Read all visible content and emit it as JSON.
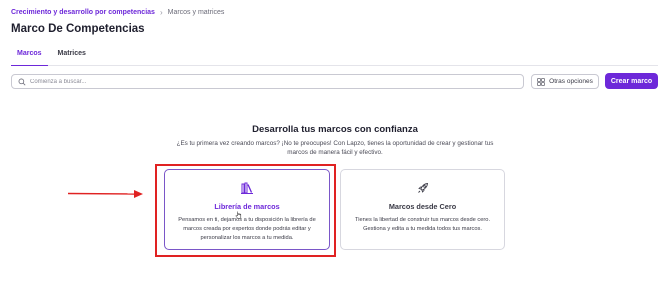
{
  "breadcrumb": {
    "parent": "Crecimiento y desarrollo por competencias",
    "separator_icon": "chevron-right-icon",
    "current": "Marcos y matrices"
  },
  "page": {
    "title": "Marco De Competencias"
  },
  "tabs": [
    {
      "label": "Marcos",
      "active": true
    },
    {
      "label": "Matrices",
      "active": false
    }
  ],
  "search": {
    "placeholder": "Comienza a buscar...",
    "value": "",
    "icon": "search-icon"
  },
  "toolbar": {
    "options_label": "Otras opciones",
    "options_icon": "grid-icon",
    "create_label": "Crear marco"
  },
  "intro": {
    "headline": "Desarrolla tus marcos con confianza",
    "subtext": "¿Es tu primera vez creando marcos? ¡No te preocupes! Con Lapzo, tienes la oportunidad de crear y gestionar tus marcos de manera fácil y efectivo."
  },
  "cards": [
    {
      "title": "Librería de marcos",
      "icon": "library-books-icon",
      "description": "Pensamos en ti, dejamos a tu disposición la librería de marcos creada por expertos donde podrás editar y personalizar los marcos a tu medida."
    },
    {
      "title": "Marcos desde Cero",
      "icon": "rocket-icon",
      "description": "Tienes la libertad de construir tus marcos desde cero. Gestiona y edita a tu medida todos tus marcos."
    }
  ],
  "colors": {
    "accent": "#6d28d9",
    "annotation_red": "#e02222",
    "text": "#1f1f2e",
    "border": "#c9c9d2"
  }
}
